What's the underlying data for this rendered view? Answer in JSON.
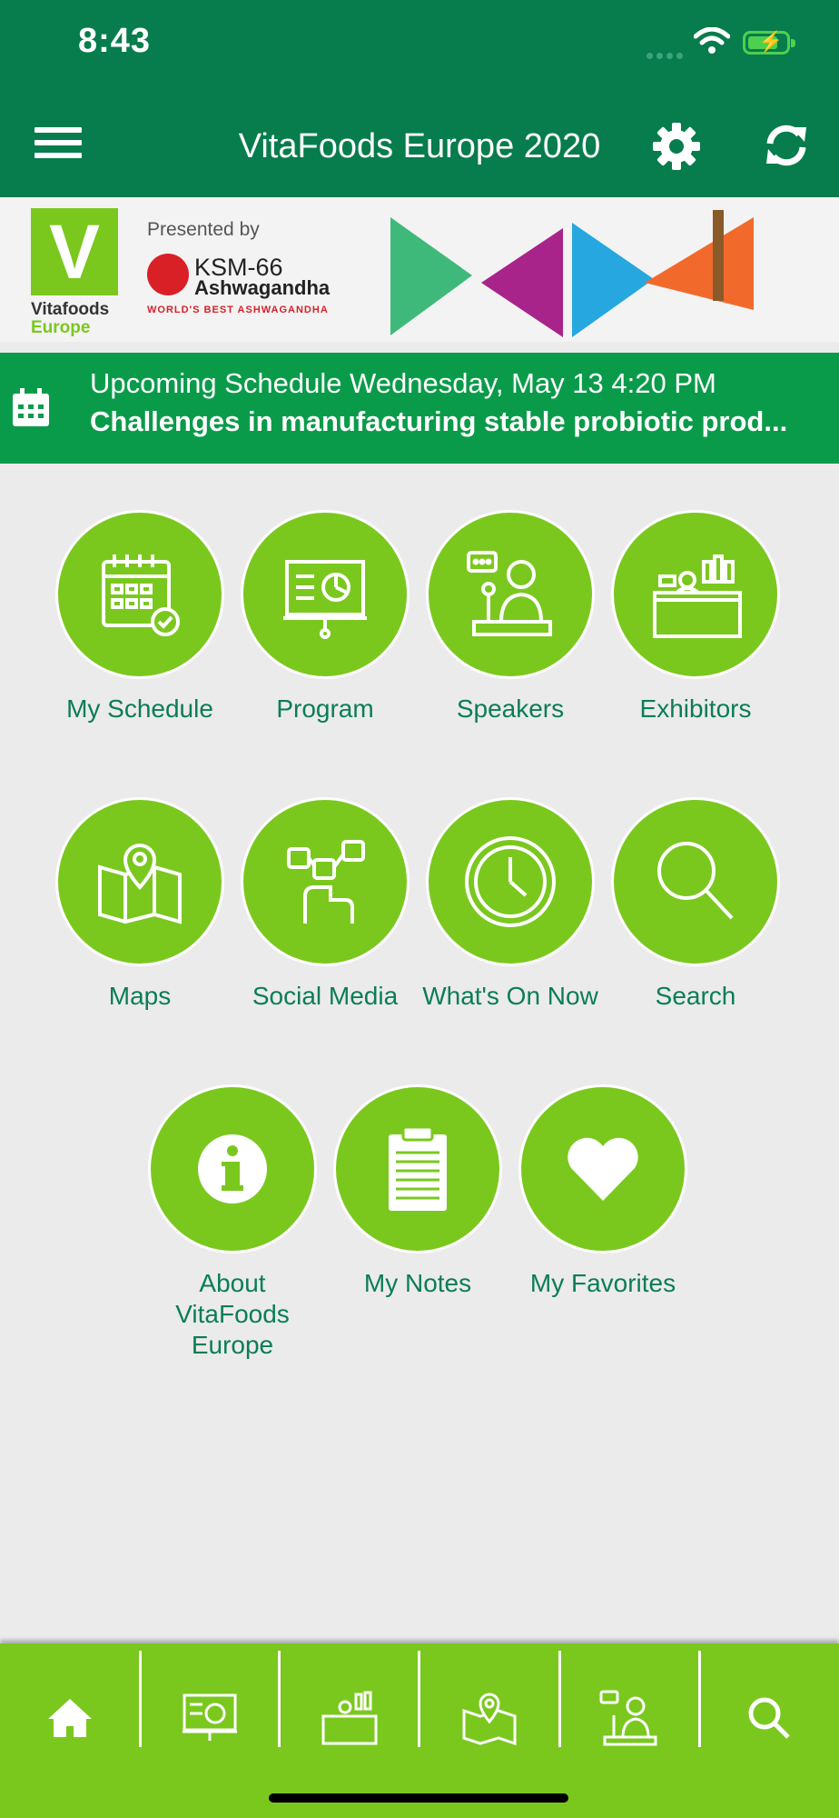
{
  "status_bar": {
    "time": "8:43"
  },
  "header": {
    "title": "VitaFoods Europe 2020"
  },
  "banner": {
    "presented_by": "Presented by",
    "event_logo_line1": "Vitafoods",
    "event_logo_line2": "Europe",
    "sponsor_line1": "KSM-66",
    "sponsor_line2": "Ashwagandha",
    "sponsor_tagline": "WORLD'S BEST ASHWAGANDHA"
  },
  "upcoming": {
    "line1": "Upcoming Schedule Wednesday, May 13 4:20 PM",
    "line2": "Challenges in manufacturing stable probiotic prod..."
  },
  "tiles": [
    {
      "label": "My Schedule"
    },
    {
      "label": "Program"
    },
    {
      "label": "Speakers"
    },
    {
      "label": "Exhibitors"
    },
    {
      "label": "Maps"
    },
    {
      "label": "Social Media"
    },
    {
      "label": "What's On Now"
    },
    {
      "label": "Search"
    },
    {
      "label": "About VitaFoods Europe"
    },
    {
      "label": "My Notes"
    },
    {
      "label": "My Favorites"
    }
  ],
  "tabbar": [
    "home-icon",
    "program-icon",
    "exhibitors-icon",
    "maps-icon",
    "speakers-icon",
    "search-icon"
  ],
  "colors": {
    "primary_dark": "#077c4c",
    "accent_green": "#7ac81e",
    "banner_green": "#0a9b4a",
    "label_teal": "#0b7d56"
  }
}
